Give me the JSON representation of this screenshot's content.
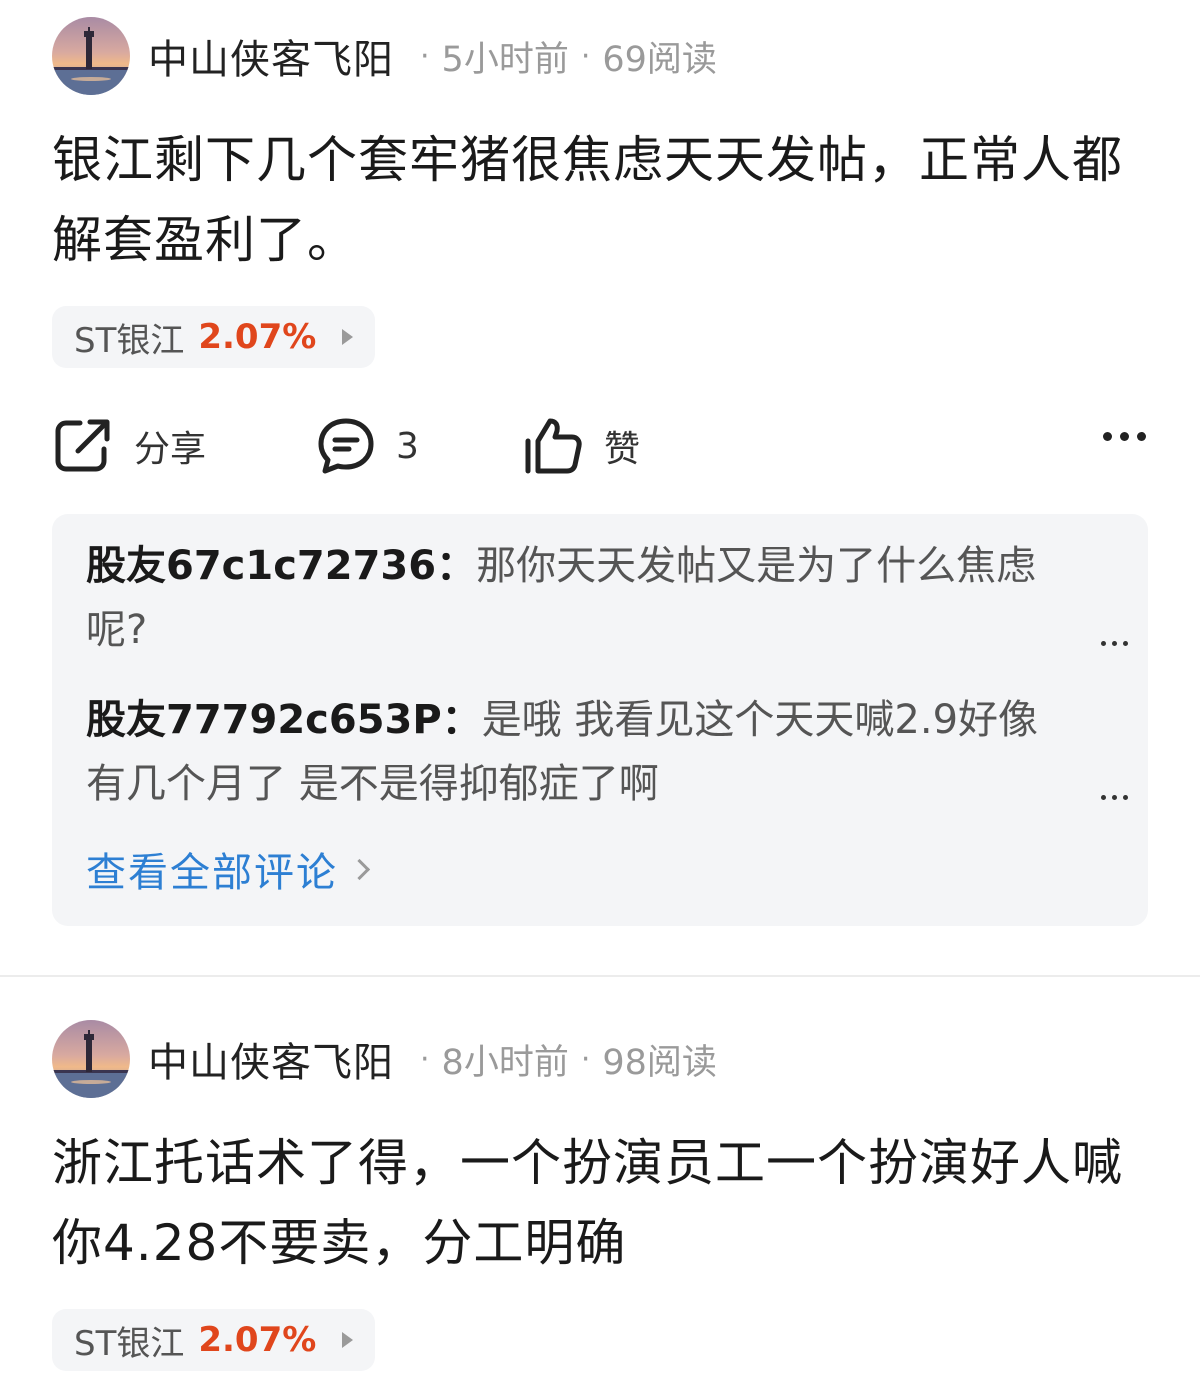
{
  "posts": [
    {
      "author": "中山侠客飞阳",
      "time": "5小时前",
      "reads": "69阅读",
      "content": "银江剩下几个套牢猪很焦虑天天发帖，正常人都解套盈利了。",
      "stock": {
        "name": "ST银江",
        "change": "2.07%"
      },
      "actions": {
        "share": "分享",
        "comments": "3",
        "like": "赞"
      },
      "comments": [
        {
          "user": "股友67c1c72736：",
          "text": "那你天天发帖又是为了什么焦虑呢?"
        },
        {
          "user": "股友77792c653P：",
          "text": "是哦 我看见这个天天喊2.9好像有几个月了 是不是得抑郁症了啊"
        }
      ],
      "view_all": "查看全部评论"
    },
    {
      "author": "中山侠客飞阳",
      "time": "8小时前",
      "reads": "98阅读",
      "content": "浙江托话术了得，一个扮演员工一个扮演好人喊你4.28不要卖，分工明确",
      "stock": {
        "name": "ST银江",
        "change": "2.07%"
      }
    }
  ],
  "colors": {
    "stock_up": "#e0461c",
    "link": "#2d7fd3",
    "meta": "#9a9a9a"
  },
  "icons": [
    "share-icon",
    "comment-icon",
    "thumbs-up-icon",
    "more-icon",
    "chevron-right-icon"
  ]
}
